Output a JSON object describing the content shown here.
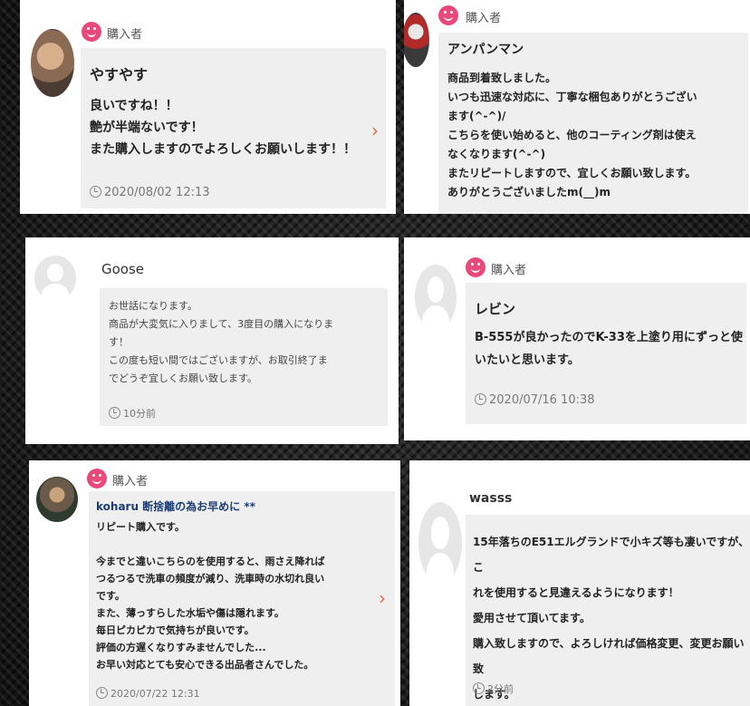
{
  "reviews": [
    {
      "role": "購入者",
      "name": "やすやす",
      "message": "良いですね！！\n艶が半端ないです！\nまた購入しますのでよろしくお願いします！！",
      "timestamp": "2020/08/02 12:13",
      "chevron": "›"
    },
    {
      "role": "購入者",
      "name": "アンパンマン",
      "message": "商品到着致しました。\nいつも迅速な対応に、丁寧な梱包ありがとうござい\nます(^-^)/\nこちらを使い始めると、他のコーティング剤は使え\nなくなります(^-^)\nまたリピートしますので、宜しくお願い致します。\nありがとうございましたm(__)m"
    },
    {
      "name": "Goose",
      "message": "お世話になります。\n商品が大変気に入りまして、3度目の購入になりま\nす！\nこの度も短い間ではございますが、お取引終了ま\nでどうぞ宜しくお願い致します。",
      "timestamp": "10分前"
    },
    {
      "role": "購入者",
      "name": "レビン",
      "message": "B-555が良かったのでK-33を上塗り用にずっと使\nいたいと思います。",
      "timestamp": "2020/07/16 10:38"
    },
    {
      "role": "購入者",
      "name": "koharu  断捨離の為お早めに **",
      "message": "リピート購入です。\n\n今までと違いこちらのを使用すると、雨さえ降れば\nつるつるで洗車の頻度が減り、洗車時の水切れ良い\nです。\nまた、薄っすらした水垢や傷は隠れます。\n毎日ピカピカで気持ちが良いです。\n評価の方遅くなりすみませんでした...\nお早い対応とても安心できる出品者さんでした。",
      "timestamp": "2020/07/22 12:31",
      "chevron": "›"
    },
    {
      "name": "wasss",
      "message": "15年落ちのE51エルグランドで小キズ等も凄いですが、こ\nれを使用すると見違えるようになります！\n愛用させて頂いてます。\n購入致しますので、よろしければ価格変更、変更お願い致\nします。",
      "timestamp": "2分前"
    }
  ]
}
